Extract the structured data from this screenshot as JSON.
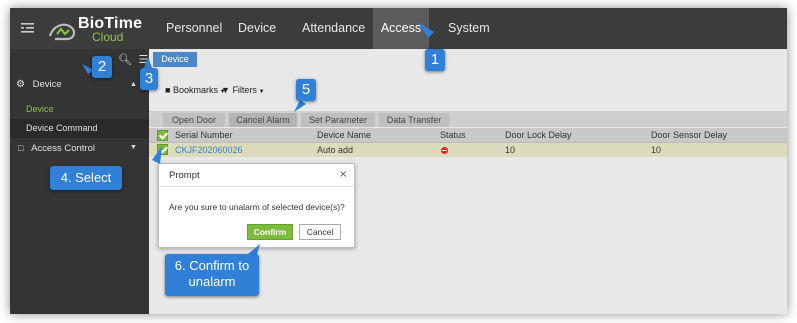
{
  "app": {
    "logo_text": "BioTime",
    "logo_subtext": "Cloud",
    "colors": {
      "accent": "#4a88c7",
      "green": "#7dbb3d",
      "callout": "#2f80d6",
      "topbar": "#3c3c3c",
      "sidebar": "#343434"
    }
  },
  "nav": {
    "items": [
      "Personnel",
      "Device",
      "Attendance",
      "Access",
      "System"
    ],
    "active": "Access"
  },
  "sidebar": {
    "section": "Device",
    "subitems": [
      "Device",
      "Device Command"
    ],
    "active_subitem": "Device",
    "section2": "Access Control"
  },
  "content": {
    "tab": "Device",
    "toolbar": {
      "bookmarks": "Bookmarks",
      "filters": "Filters"
    },
    "op_buttons": [
      "Open Door",
      "Cancel Alarm",
      "Set Parameter",
      "Data Transfer"
    ],
    "table": {
      "columns": [
        "Serial Number",
        "Device Name",
        "Status",
        "Door Lock Delay",
        "Door Sensor Delay"
      ],
      "rows": [
        {
          "serial": "CKJF202060026",
          "name": "Auto add",
          "status": "offline",
          "lock_delay": "10",
          "sensor_delay": "10"
        }
      ]
    }
  },
  "dialog": {
    "title": "Prompt",
    "close": "×",
    "message": "Are you sure to unalarm of selected device(s)?",
    "confirm": "Confirm",
    "cancel": "Cancel"
  },
  "callouts": {
    "c1": "1",
    "c2": "2",
    "c3": "3",
    "c4": "4. Select",
    "c5": "5",
    "c6_line1": "6. Confirm to",
    "c6_line2": "unalarm"
  }
}
